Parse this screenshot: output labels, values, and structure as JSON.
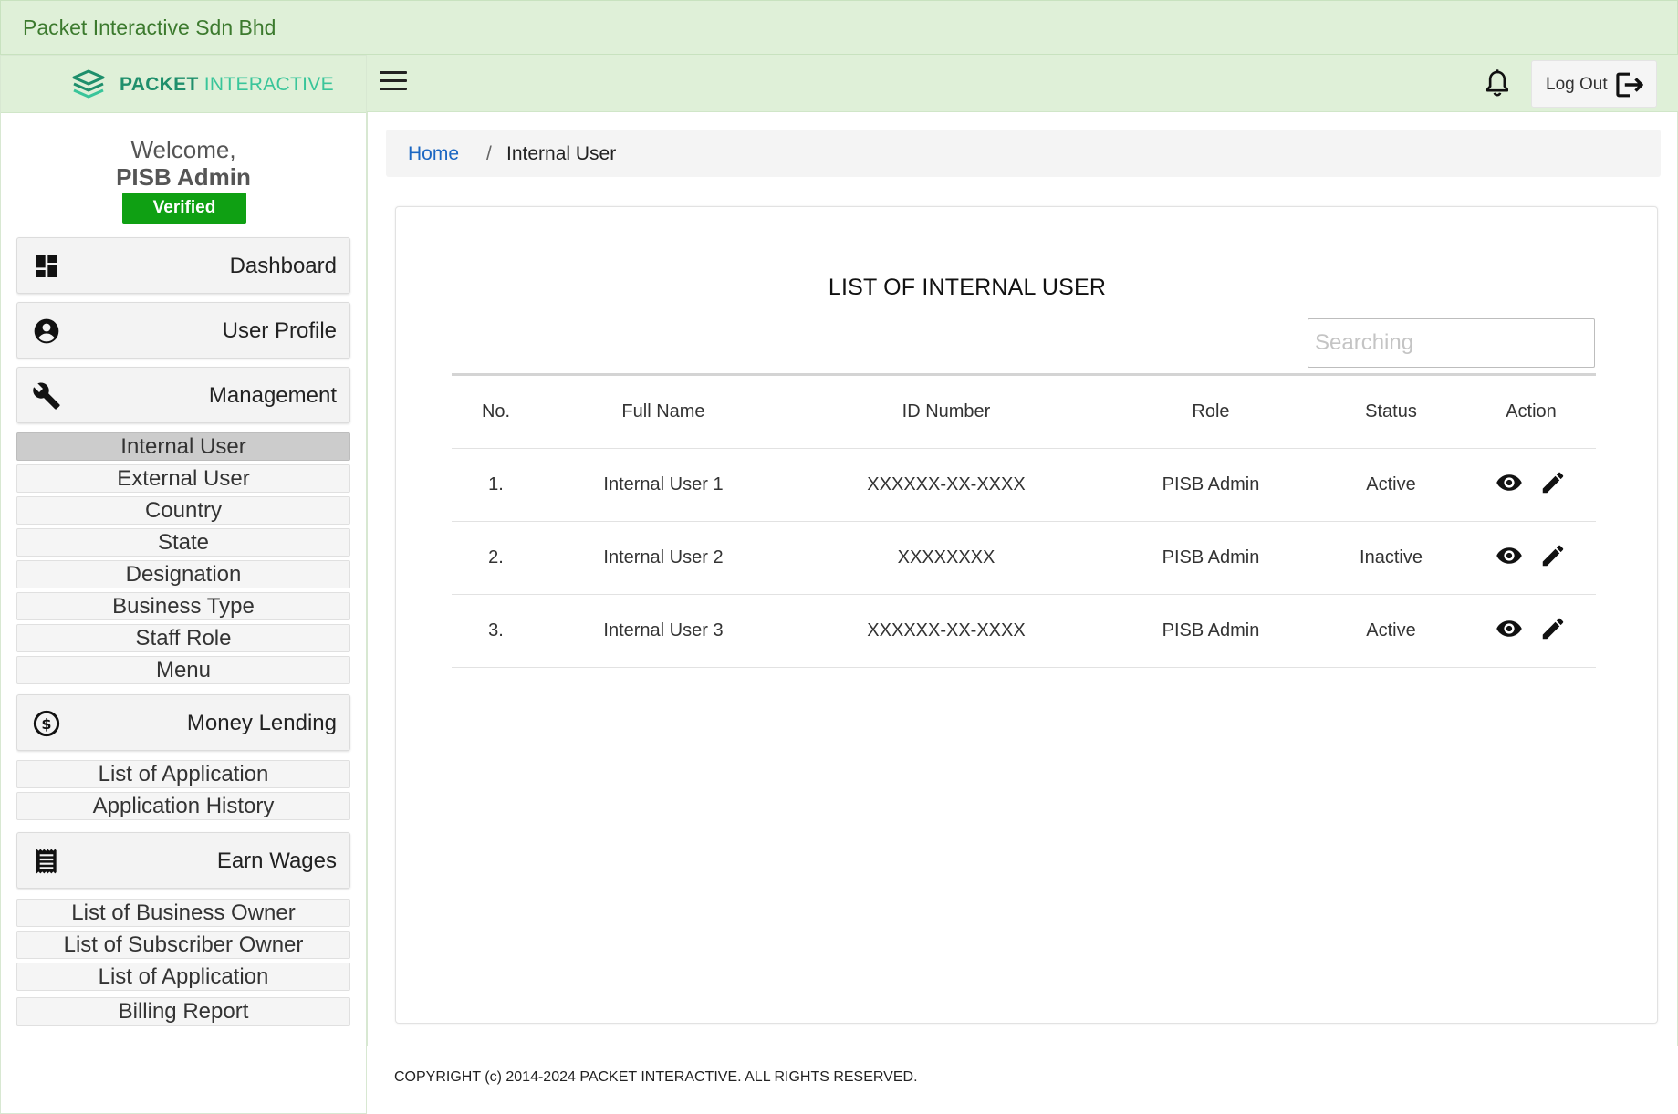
{
  "company": {
    "name": "Packet Interactive Sdn Bhd"
  },
  "logo": {
    "word1": "PACKET",
    "word2": "INTERACTIVE",
    "brand_color": "#1f8f6c"
  },
  "user": {
    "welcome": "Welcome,",
    "name": "PISB Admin",
    "badge": "Verified"
  },
  "sidebar": {
    "dashboard": {
      "label": "Dashboard",
      "icon": "dashboard-icon"
    },
    "profile": {
      "label": "User Profile",
      "icon": "account-circle-icon"
    },
    "management": {
      "label": "Management",
      "icon": "wrench-icon",
      "items": [
        "Internal User",
        "External User",
        "Country",
        "State",
        "Designation",
        "Business Type",
        "Staff Role",
        "Menu"
      ]
    },
    "money_lending": {
      "label": "Money Lending",
      "icon": "dollar-circle-icon",
      "items": [
        "List of Application",
        "Application History"
      ]
    },
    "earn_wages": {
      "label": "Earn Wages",
      "icon": "receipt-icon",
      "items": [
        "List of Business Owner",
        "List of Subscriber Owner",
        "List of Application",
        "Billing Report"
      ]
    }
  },
  "header": {
    "logout": "Log Out"
  },
  "breadcrumb": {
    "home": "Home",
    "separator": "/",
    "current": "Internal User"
  },
  "main": {
    "title": "LIST OF INTERNAL USER",
    "search_placeholder": "Searching",
    "table": {
      "headers": [
        "No.",
        "Full Name",
        "ID Number",
        "Role",
        "Status",
        "Action"
      ],
      "rows": [
        {
          "no": "1.",
          "name": "Internal User 1",
          "id": "XXXXXX-XX-XXXX",
          "role": "PISB Admin",
          "status": "Active"
        },
        {
          "no": "2.",
          "name": "Internal User 2",
          "id": "XXXXXXXX",
          "role": "PISB Admin",
          "status": "Inactive"
        },
        {
          "no": "3.",
          "name": "Internal User 3",
          "id": "XXXXXX-XX-XXXX",
          "role": "PISB Admin",
          "status": "Active"
        }
      ]
    }
  },
  "footer": {
    "copyright": "COPYRIGHT (c) 2014-2024 PACKET INTERACTIVE. ALL RIGHTS RESERVED."
  },
  "colors": {
    "header_bg": "#dff0d8",
    "verified": "#0fa013",
    "link": "#1a66c2"
  }
}
